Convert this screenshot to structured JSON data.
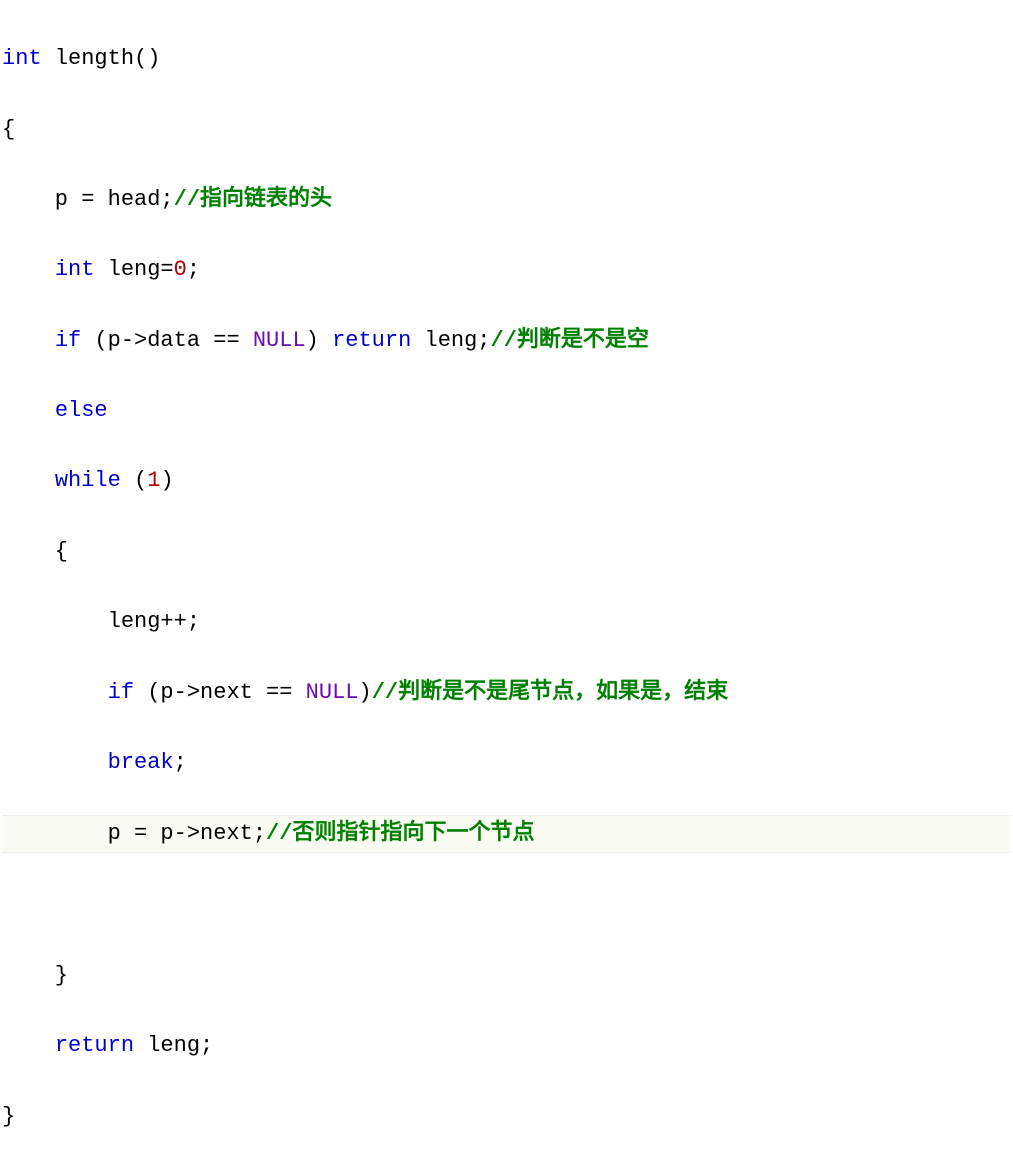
{
  "code": {
    "l1": {
      "kw1": "int",
      "fn": " length()"
    },
    "l2": {
      "brace": "{"
    },
    "l3": {
      "txt1": "    p = head;",
      "cm": "//指向链表的头"
    },
    "l4": {
      "kw1": "int",
      "txt1": " leng=",
      "num": "0",
      "txt2": ";"
    },
    "l5": {
      "kw1": "if",
      "txt1": " (p->data == ",
      "null": "NULL",
      "txt2": ") ",
      "kw2": "return",
      "txt3": " leng;",
      "cm": "//判断是不是空"
    },
    "l6": {
      "kw1": "else"
    },
    "l7": {
      "kw1": "while",
      "txt1": " (",
      "num": "1",
      "txt2": ")"
    },
    "l8": {
      "brace": "    {"
    },
    "l9": {
      "txt1": "        leng++;"
    },
    "l10": {
      "kw1": "if",
      "txt1": " (p->next == ",
      "null": "NULL",
      "txt2": ")",
      "cm": "//判断是不是尾节点，如果是，结束"
    },
    "l11": {
      "kw1": "break",
      "txt1": ";"
    },
    "l12": {
      "txt1": "        p = p->next;",
      "cm": "//否则指针指向下一个节点"
    },
    "l13": {
      "brace": "    }"
    },
    "l14": {
      "kw1": "return",
      "txt1": " leng;"
    },
    "l15": {
      "brace": "}"
    }
  }
}
